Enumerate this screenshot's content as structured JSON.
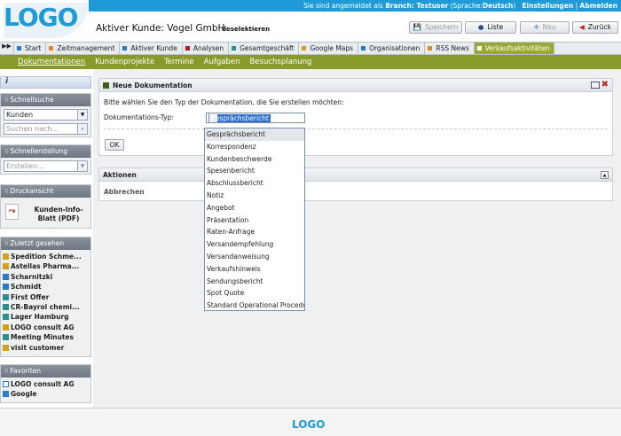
{
  "logo": "LOGO",
  "header": {
    "user_strip": {
      "prefix": "Sie sind angemeldet als",
      "branch": "Branch: Testuser",
      "lang_prefix": "(Sprache:",
      "lang": "Deutsch",
      "lang_suffix": ")",
      "settings": "Einstellungen",
      "sep": "|",
      "logout": "Abmelden"
    },
    "active_customer": "Aktiver Kunde: Vogel GmbH",
    "deselect": "deselektieren",
    "buttons": {
      "save": "Speichern",
      "list": "Liste",
      "new": "Neu",
      "back": "Zurück"
    }
  },
  "nav_tabs": [
    {
      "label": "Start",
      "color": "#2a7bd0"
    },
    {
      "label": "Zeitmanagement",
      "color": "#e08a1a"
    },
    {
      "label": "Aktiver Kunde",
      "color": "#2a7bd0"
    },
    {
      "label": "Analysen",
      "color": "#b01a1a"
    },
    {
      "label": "Gesamtgeschäft",
      "color": "#2a9090"
    },
    {
      "label": "Google Maps",
      "color": "#d4a017"
    },
    {
      "label": "Organisationen",
      "color": "#2a7bd0"
    },
    {
      "label": "RSS News",
      "color": "#e08a1a"
    },
    {
      "label": "Verkaufsaktivitäten",
      "color": "#ffffff",
      "active": true
    }
  ],
  "sub_nav": [
    "Dokumentationen",
    "Kundenprojekte",
    "Termine",
    "Aufgaben",
    "Besuchsplanung"
  ],
  "sidebar": {
    "info": "i",
    "quicksearch": {
      "title": "Schnellsuche",
      "select_value": "Kunden",
      "search_placeholder": "Suchen nach..."
    },
    "quickcreate": {
      "title": "Schnellerstellung",
      "select_value": "Erstellen..."
    },
    "print": {
      "title": "Druckansicht",
      "item": "Kunden-Info-Blatt (PDF)"
    },
    "recent": {
      "title": "Zuletzt gesehen",
      "items": [
        "Spedition Schme...",
        "Astellas Pharma...",
        "Scharnitzki",
        "Schmidt",
        "First Offer",
        "CR-Bayrol chemi...",
        "Lager Hamburg",
        "LOGO consult AG",
        "Meeting Minutes",
        "visit customer"
      ],
      "icons": [
        "#d4a017",
        "#d4a017",
        "#2a7bd0",
        "#2a7bd0",
        "#2a9090",
        "#2a9090",
        "#2a9090",
        "#d4a017",
        "#2a9090",
        "#d4a017"
      ]
    },
    "favorites": {
      "title": "Favoriten",
      "items": [
        "LOGO consult AG",
        "Google"
      ]
    }
  },
  "main": {
    "doc_panel": {
      "title": "Neue Dokumentation",
      "hint": "Bitte wählen Sie den Typ der Dokumentation, die Sie erstellen möchten:",
      "type_label": "Dokumentations-Typ:",
      "type_value": "Gesprächsbericht",
      "ok": "OK"
    },
    "actions_panel": {
      "title": "Aktionen",
      "cancel": "Abbrechen"
    },
    "type_options": [
      "Gesprächsbericht",
      "Korrespondenz",
      "Kundenbeschwerde",
      "Spesenbericht",
      "Abschlussbericht",
      "Notiz",
      "Angebot",
      "Präsentation",
      "Raten-Anfrage",
      "Versandempfehlung",
      "Versandanweisung",
      "Verkaufshinweis",
      "Sendungsbericht",
      "Spot Quote",
      "Standard Operational Procedure"
    ]
  },
  "footer": {
    "logo": "LOGO"
  }
}
